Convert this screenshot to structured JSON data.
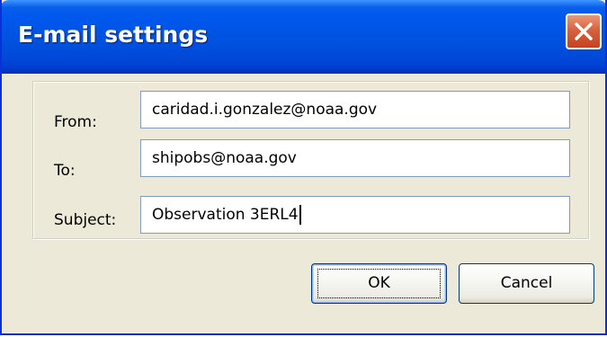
{
  "window": {
    "title": "E-mail settings",
    "close_icon": "close-icon"
  },
  "form": {
    "from": {
      "label": "From:",
      "value": "caridad.i.gonzalez@noaa.gov"
    },
    "to": {
      "label": "To:",
      "value": "shipobs@noaa.gov"
    },
    "subject": {
      "label": "Subject:",
      "value": "Observation 3ERL4"
    }
  },
  "buttons": {
    "ok_label": "OK",
    "cancel_label": "Cancel"
  },
  "colors": {
    "titlebar": "#0054e3",
    "close_button": "#d86240",
    "dialog_background": "#ece9d8",
    "input_border": "#7f9db9"
  }
}
